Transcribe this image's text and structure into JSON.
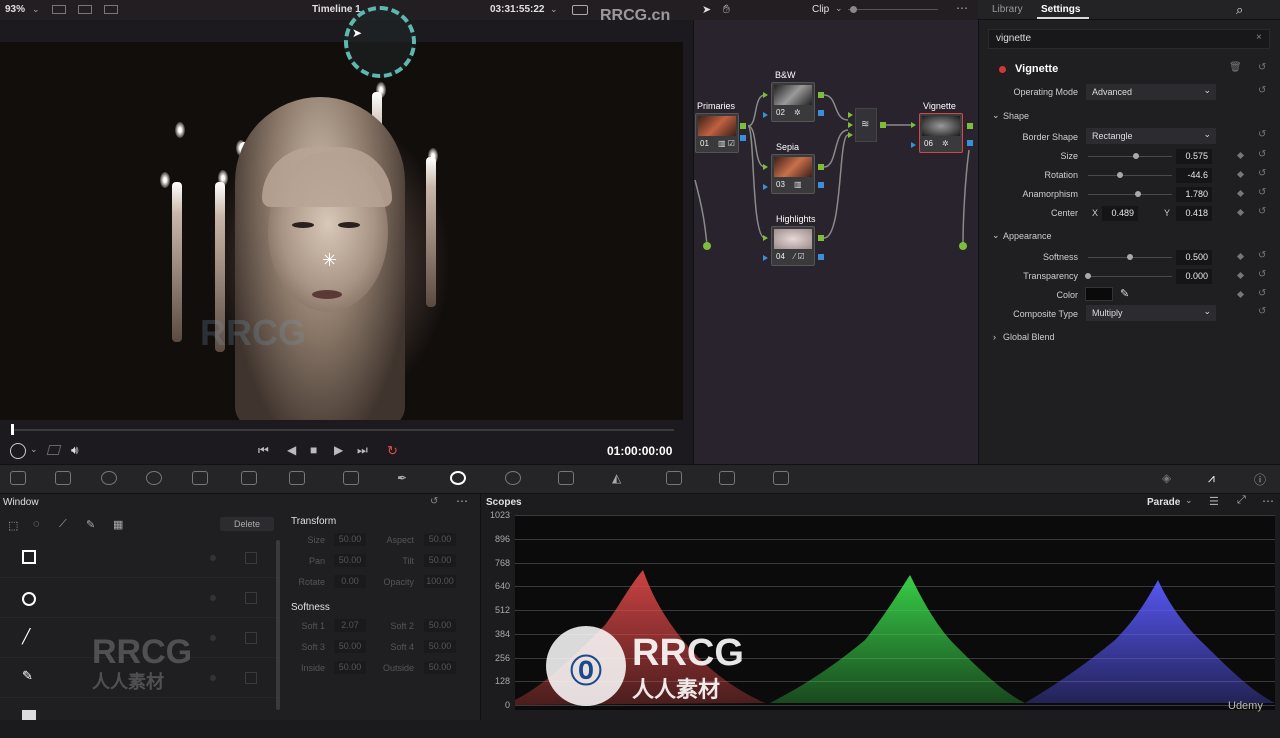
{
  "viewer": {
    "zoom": "93%",
    "timeline_name": "Timeline 1",
    "timecode_top": "03:31:55:22",
    "playhead_timecode": "01:00:00:00"
  },
  "nodes": {
    "mode": "Clip",
    "items": [
      {
        "label": "Primaries",
        "num": "01"
      },
      {
        "label": "B&W",
        "num": "02"
      },
      {
        "label": "Sepia",
        "num": "03"
      },
      {
        "label": "Highlights",
        "num": "04"
      },
      {
        "label": "Vignette",
        "num": "06"
      }
    ]
  },
  "inspector": {
    "tab_library": "Library",
    "tab_settings": "Settings",
    "search_value": "vignette",
    "effect_name": "Vignette",
    "operating_mode_label": "Operating Mode",
    "operating_mode_value": "Advanced",
    "shape_section": "Shape",
    "border_shape_label": "Border Shape",
    "border_shape_value": "Rectangle",
    "size_label": "Size",
    "size_value": "0.575",
    "rotation_label": "Rotation",
    "rotation_value": "-44.6",
    "anamorphism_label": "Anamorphism",
    "anamorphism_value": "1.780",
    "center_label": "Center",
    "center_x_label": "X",
    "center_x_value": "0.489",
    "center_y_label": "Y",
    "center_y_value": "0.418",
    "appearance_section": "Appearance",
    "softness_label": "Softness",
    "softness_value": "0.500",
    "transparency_label": "Transparency",
    "transparency_value": "0.000",
    "color_label": "Color",
    "composite_type_label": "Composite Type",
    "composite_type_value": "Multiply",
    "global_blend_section": "Global Blend",
    "size_level": 0.575,
    "rotation_level": 0.38,
    "anamorphism_level": 0.59,
    "softness_level": 0.5,
    "transparency_level": 0.0,
    "color_swatch": "#0a0a0a"
  },
  "window_panel": {
    "title": "Window",
    "delete_label": "Delete",
    "transform_title": "Transform",
    "transform": [
      {
        "label": "Size",
        "value": "50.00"
      },
      {
        "label": "Aspect",
        "value": "50.00"
      },
      {
        "label": "Pan",
        "value": "50.00"
      },
      {
        "label": "Tilt",
        "value": "50.00"
      },
      {
        "label": "Rotate",
        "value": "0.00"
      },
      {
        "label": "Opacity",
        "value": "100.00"
      }
    ],
    "softness_title": "Softness",
    "softness": [
      {
        "label": "Soft 1",
        "value": "2.07"
      },
      {
        "label": "Soft 2",
        "value": "50.00"
      },
      {
        "label": "Soft 3",
        "value": "50.00"
      },
      {
        "label": "Soft 4",
        "value": "50.00"
      },
      {
        "label": "Inside",
        "value": "50.00"
      },
      {
        "label": "Outside",
        "value": "50.00"
      }
    ]
  },
  "scopes": {
    "title": "Scopes",
    "mode": "Parade",
    "ticks": [
      "1023",
      "896",
      "768",
      "640",
      "512",
      "384",
      "256",
      "128",
      "0"
    ],
    "colors": {
      "red": "#e04848",
      "green": "#3ad84a",
      "blue": "#5a5aff"
    }
  },
  "watermarks": {
    "top": "RRCG.cn",
    "logo": "RRCG",
    "logo_sub": "人人素材",
    "udemy": "Udemy"
  }
}
